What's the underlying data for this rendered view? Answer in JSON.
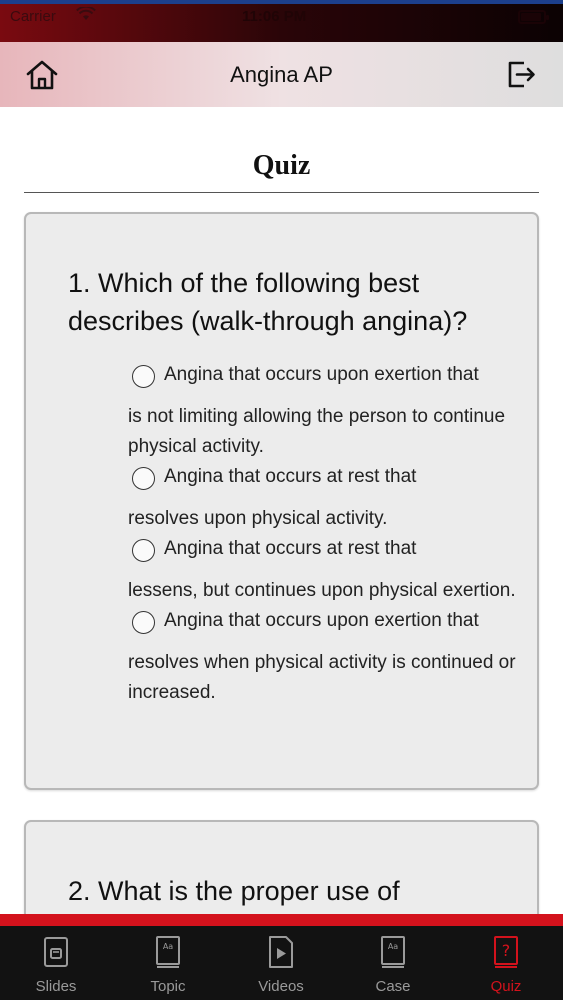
{
  "status_bar": {
    "carrier": "Carrier",
    "time": "11:06 PM",
    "battery_level": 0.85
  },
  "nav": {
    "title": "Angina AP",
    "home_icon": "home-icon",
    "logout_icon": "logout-icon"
  },
  "page": {
    "title": "Quiz"
  },
  "questions": [
    {
      "text": "1. Which of the following best describes (walk-through angina)?",
      "options": [
        {
          "first": "Angina that occurs upon exertion that",
          "rest": "is not limiting allowing the person to continue physical activity."
        },
        {
          "first": "Angina that occurs at rest that",
          "rest": "resolves upon physical activity."
        },
        {
          "first": "Angina that occurs at rest that",
          "rest": "lessens, but continues upon physical exertion."
        },
        {
          "first": "Angina that occurs upon exertion that",
          "rest": "resolves when physical activity is continued or increased."
        }
      ]
    },
    {
      "text": "2. What is the proper use of"
    }
  ],
  "tabs": [
    {
      "label": "Slides",
      "icon": "slides-icon"
    },
    {
      "label": "Topic",
      "icon": "book-icon"
    },
    {
      "label": "Videos",
      "icon": "video-icon"
    },
    {
      "label": "Case",
      "icon": "book-icon"
    },
    {
      "label": "Quiz",
      "icon": "question-icon",
      "active": true
    }
  ],
  "colors": {
    "accent": "#d3121c",
    "tab_inactive": "#9a9a9a",
    "tab_bar_bg": "#121212"
  }
}
